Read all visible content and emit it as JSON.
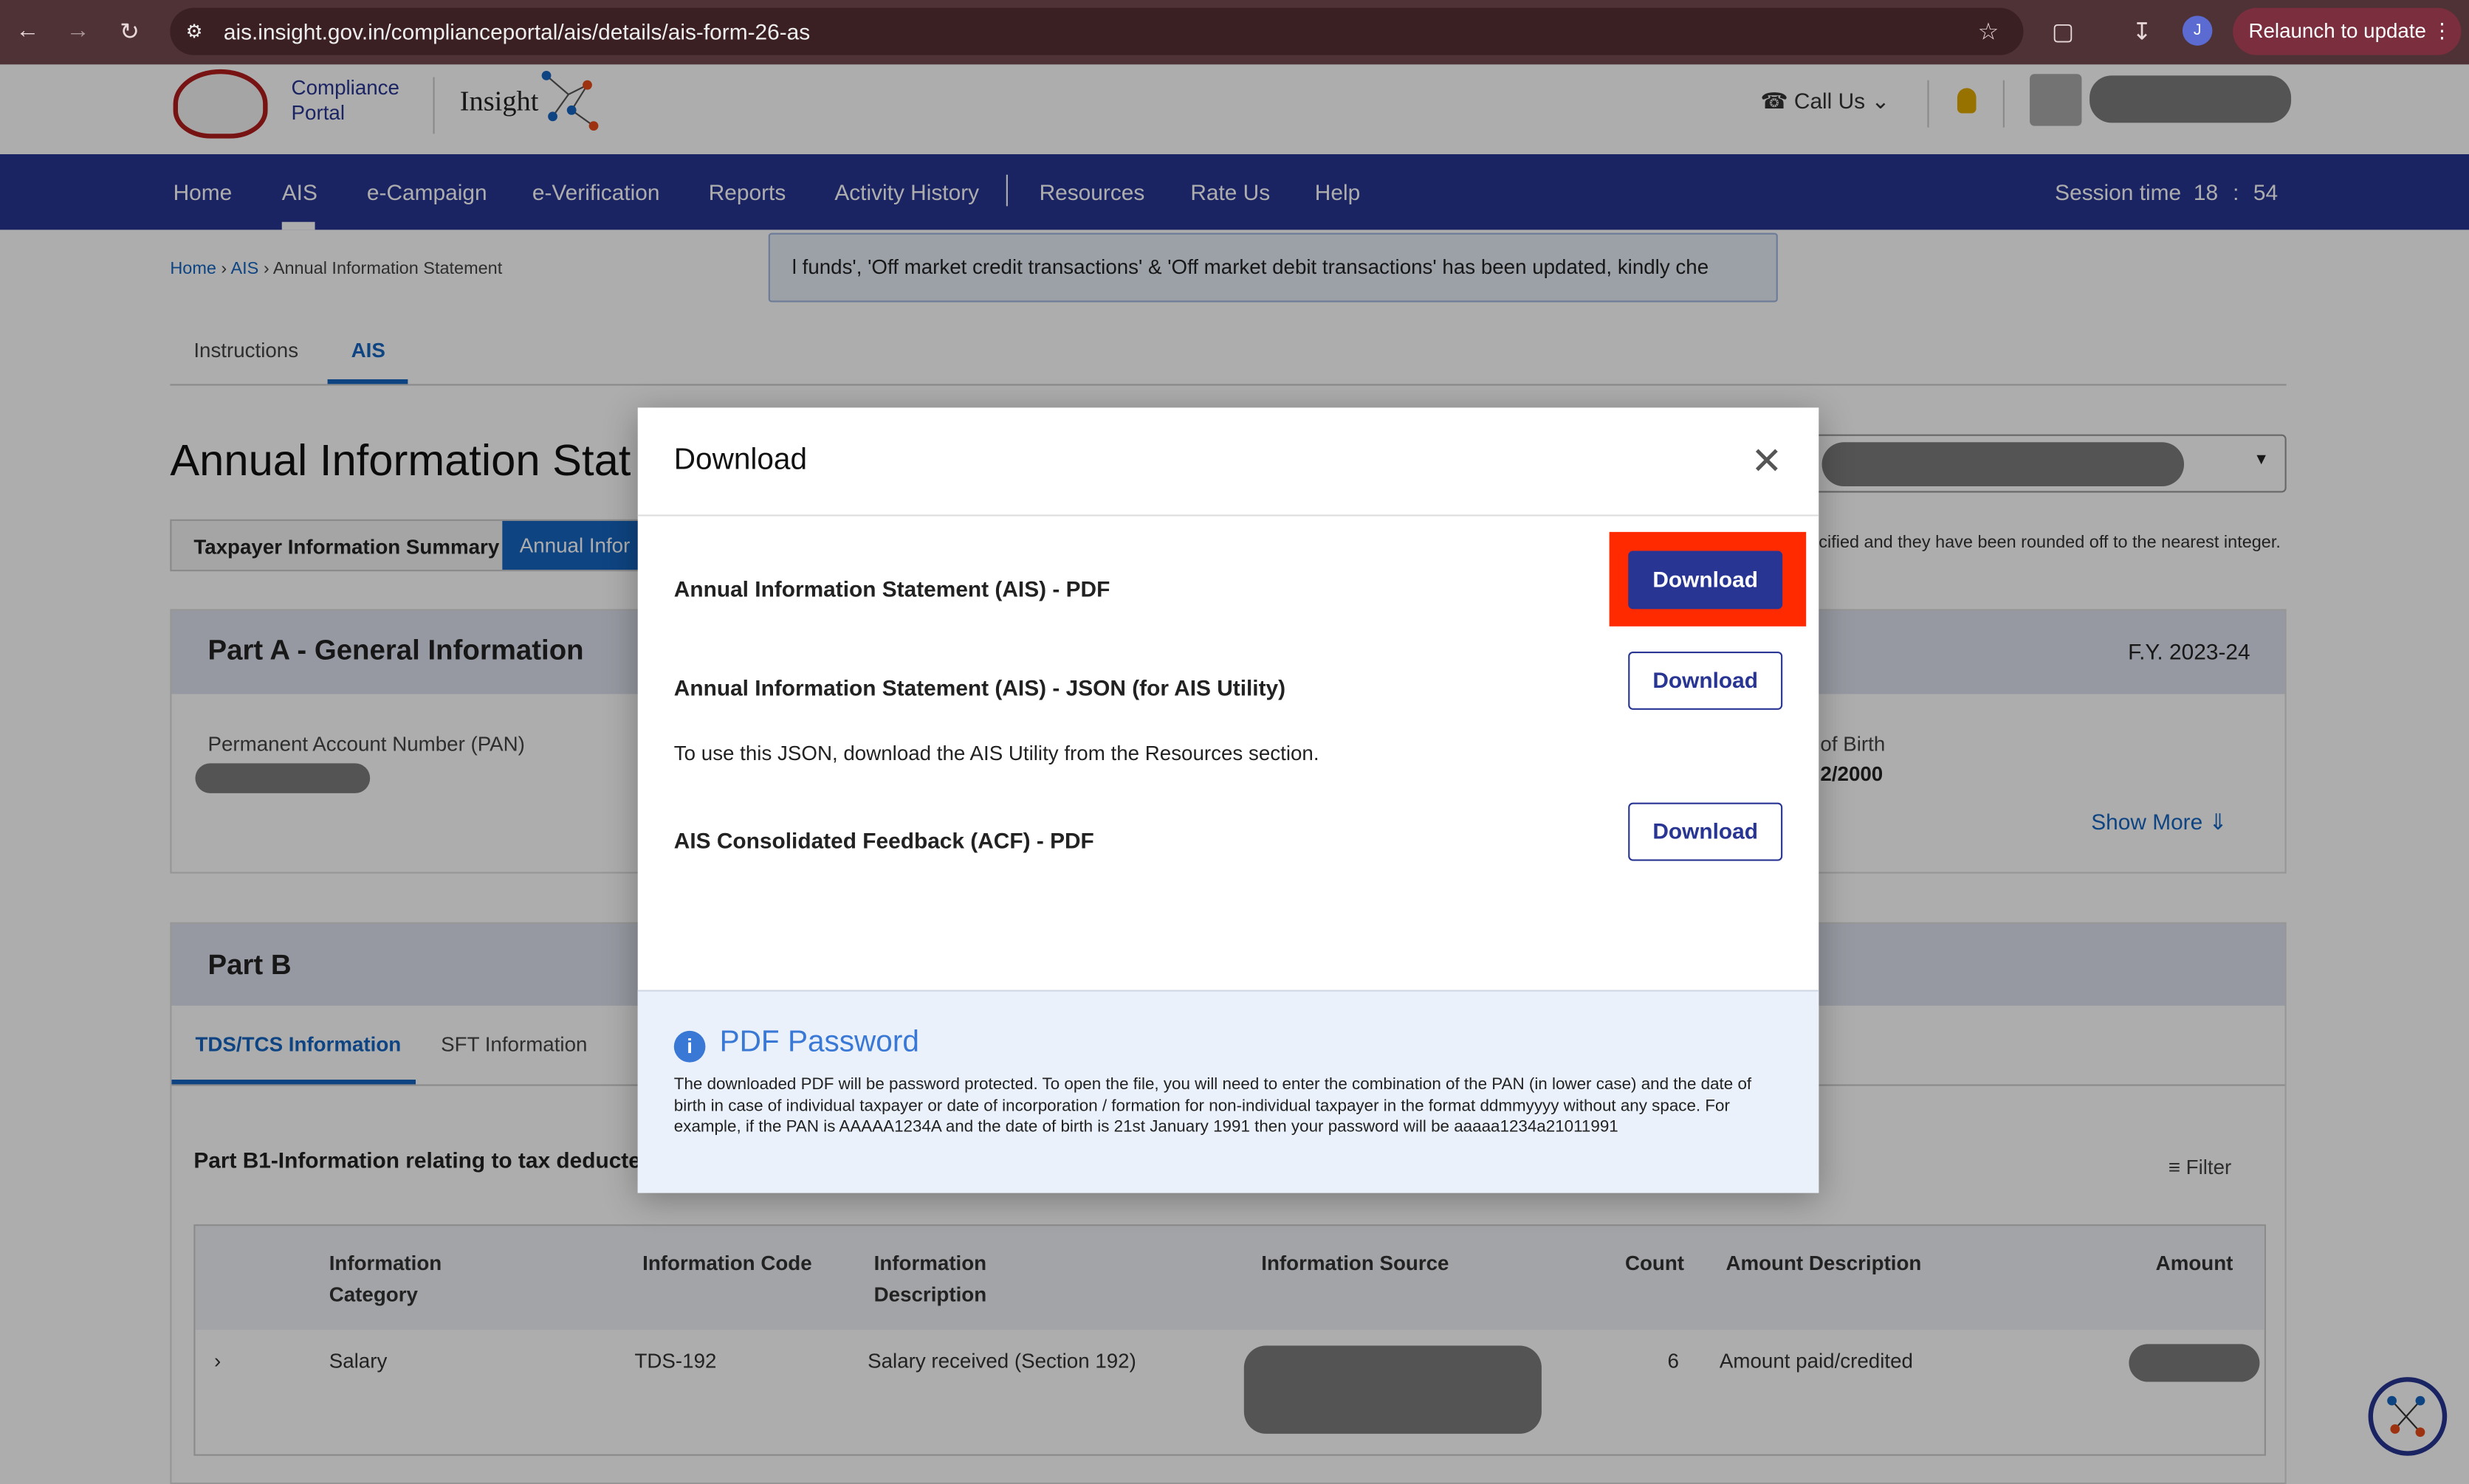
{
  "browser": {
    "url": "ais.insight.gov.in/complianceportal/ais/details/ais-form-26-as",
    "relaunch": "Relaunch to update",
    "profile_initial": "J"
  },
  "header": {
    "logo_line1": "Compliance",
    "logo_line2": "Portal",
    "insight": "Insight",
    "call_us": "Call Us"
  },
  "nav": {
    "items": [
      "Home",
      "AIS",
      "e-Campaign",
      "e-Verification",
      "Reports",
      "Activity History",
      "Resources",
      "Rate Us",
      "Help"
    ],
    "session_label": "Session time",
    "session_min": "18",
    "session_sep": ":",
    "session_sec": "54"
  },
  "breadcrumb": [
    "Home",
    "AIS",
    "Annual Information Statement"
  ],
  "ticker": "l funds', 'Off market credit transactions' & 'Off market debit transactions' has been updated, kindly che",
  "tabs": [
    "Instructions",
    "AIS"
  ],
  "page_title": "Annual Information Stat",
  "subtabs": [
    "Taxpayer Information Summary",
    "Annual Infor"
  ],
  "note": "cified and they have been rounded off to the nearest integer.",
  "partA": {
    "title": "Part A - General Information",
    "fy": "F.Y. 2023-24",
    "pan_label": "Permanent Account Number (PAN)",
    "dob_label": "of Birth",
    "dob_value": "2/2000",
    "show_more": "Show More"
  },
  "partB": {
    "title": "Part B",
    "tabs": [
      "TDS/TCS Information",
      "SFT Information"
    ],
    "b1_title": "Part B1-Information relating to tax deducte",
    "filter": "Filter",
    "columns": [
      "Information Category",
      "Information Code",
      "Information Description",
      "Information Source",
      "Count",
      "Amount Description",
      "Amount"
    ],
    "rows": [
      {
        "category": "Salary",
        "code": "TDS-192",
        "description": "Salary received (Section 192)",
        "count": "6",
        "amount_description": "Amount paid/credited"
      }
    ]
  },
  "modal": {
    "title": "Download",
    "items": [
      {
        "label": "Annual Information Statement (AIS) - PDF",
        "button": "Download"
      },
      {
        "label": "Annual Information Statement (AIS) - JSON (for AIS Utility)",
        "button": "Download",
        "note": "To use this JSON, download the AIS Utility from the Resources section."
      },
      {
        "label": "AIS Consolidated Feedback (ACF) - PDF",
        "button": "Download"
      }
    ],
    "password_title": "PDF Password",
    "password_text": "The downloaded PDF will be password protected. To open the file, you will need to enter the combination of the PAN (in lower case) and the date of birth in case of individual taxpayer or date of incorporation / formation for non-individual taxpayer in the format ddmmyyyy without any space. For example, if the PAN is AAAAA1234A and the date of birth is 21st January 1991 then your password will be aaaaa1234a21011991"
  },
  "colors": {
    "brand": "#283593",
    "highlight": "#ff2a00",
    "link": "#1565c0"
  }
}
